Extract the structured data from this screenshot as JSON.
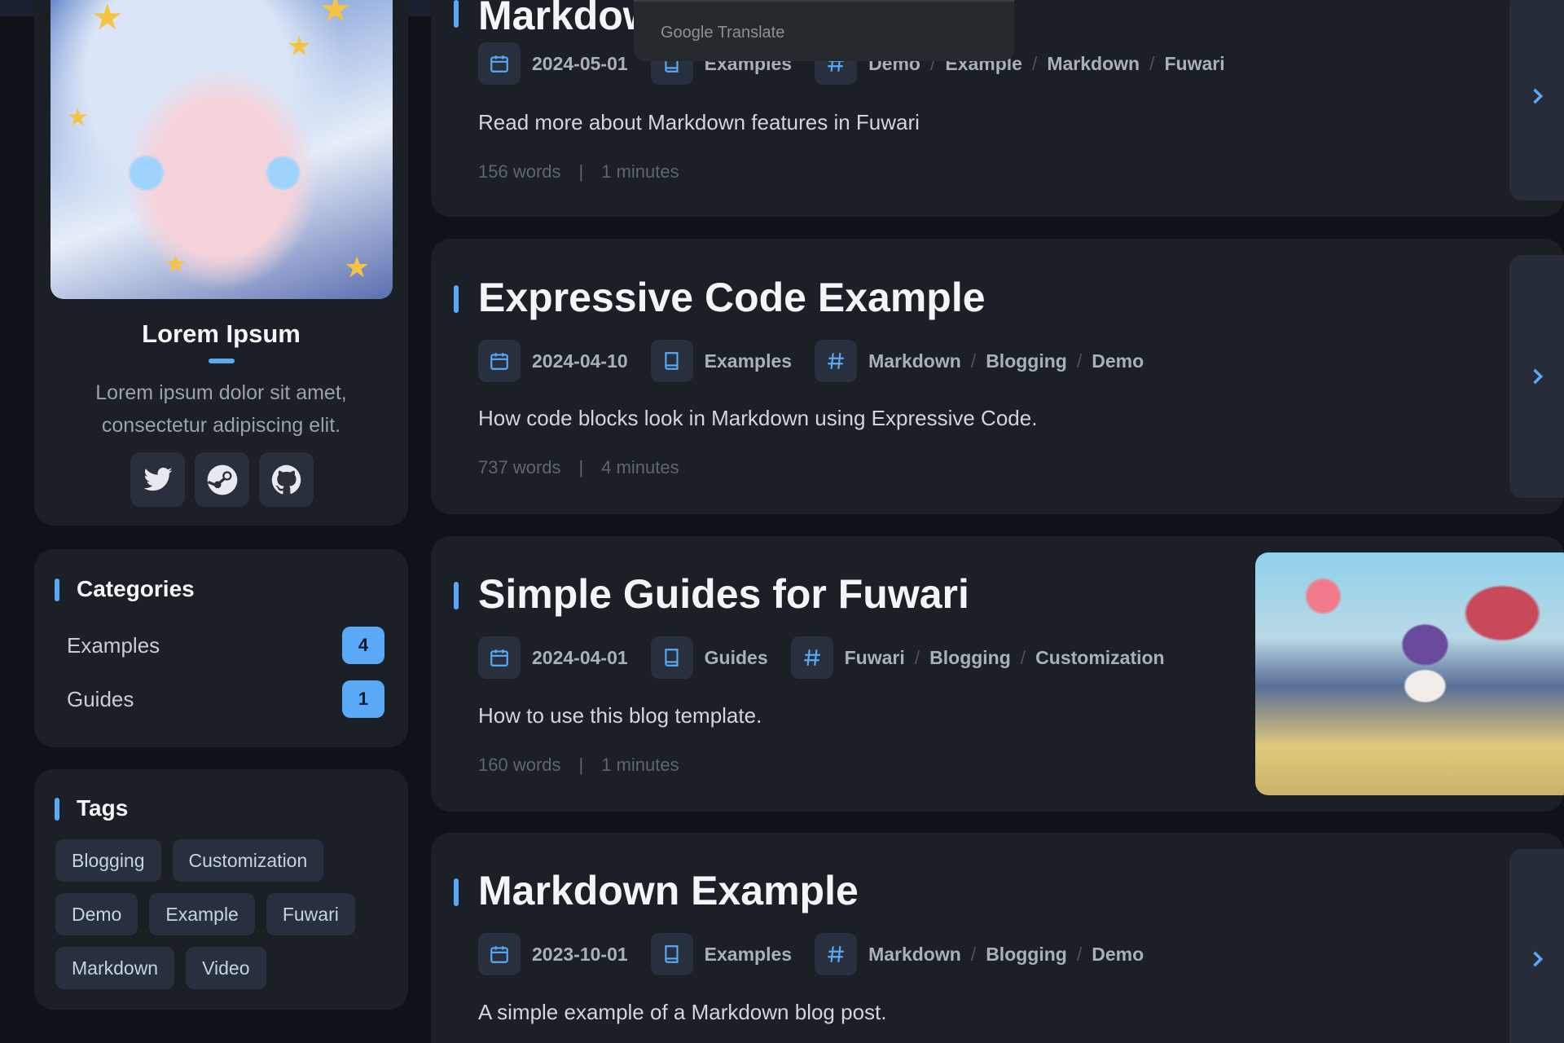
{
  "profile": {
    "name": "Lorem Ipsum",
    "bio": "Lorem ipsum dolor sit amet, consectetur adipiscing elit.",
    "social": [
      "twitter-icon",
      "steam-icon",
      "github-icon"
    ]
  },
  "categories": {
    "title": "Categories",
    "items": [
      {
        "label": "Examples",
        "count": "4"
      },
      {
        "label": "Guides",
        "count": "1"
      }
    ]
  },
  "tags": {
    "title": "Tags",
    "items": [
      "Blogging",
      "Customization",
      "Demo",
      "Example",
      "Fuwari",
      "Markdown",
      "Video"
    ]
  },
  "translate": {
    "label": "Google Translate"
  },
  "posts": [
    {
      "title": "Markdow",
      "date": "2024-05-01",
      "category": "Examples",
      "tags": [
        "Demo",
        "Example",
        "Markdown",
        "Fuwari"
      ],
      "description": "Read more about Markdown features in Fuwari",
      "words": "156 words",
      "sep": "|",
      "minutes": "1 minutes"
    },
    {
      "title": "Expressive Code Example",
      "date": "2024-04-10",
      "category": "Examples",
      "tags": [
        "Markdown",
        "Blogging",
        "Demo"
      ],
      "description": "How code blocks look in Markdown using Expressive Code.",
      "words": "737 words",
      "sep": "|",
      "minutes": "4 minutes"
    },
    {
      "title": "Simple Guides for Fuwari",
      "date": "2024-04-01",
      "category": "Guides",
      "tags": [
        "Fuwari",
        "Blogging",
        "Customization"
      ],
      "description": "How to use this blog template.",
      "words": "160 words",
      "sep": "|",
      "minutes": "1 minutes"
    },
    {
      "title": "Markdown Example",
      "date": "2023-10-01",
      "category": "Examples",
      "tags": [
        "Markdown",
        "Blogging",
        "Demo"
      ],
      "description": "A simple example of a Markdown blog post."
    }
  ],
  "colors": {
    "accent": "#5aa9f6",
    "card": "#1b1f26",
    "background": "#0f1218"
  }
}
